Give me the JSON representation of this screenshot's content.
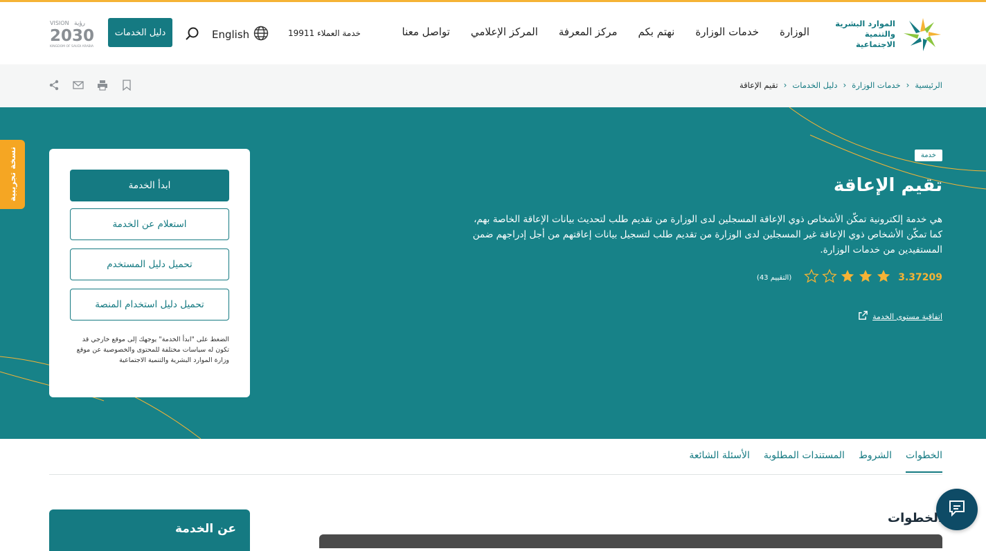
{
  "header": {
    "logo_line1": "الموارد البشرية",
    "logo_line2": "والتنمية الاجتماعية",
    "nav": [
      "الوزارة",
      "خدمات الوزارة",
      "نهتم بكم",
      "مركز المعرفة",
      "المركز الإعلامي",
      "تواصل معنا"
    ],
    "customer_service": "خدمة العملاء 19911",
    "language": "English",
    "services_guide_button": "دليل الخدمات",
    "vision_text": "VISION 2030",
    "vision_subtext": "KINGDOM OF SAUDI ARABIA",
    "vision_arabic": "رؤية"
  },
  "breadcrumb": {
    "items": [
      "الرئيسية",
      "خدمات الوزارة",
      "دليل الخدمات"
    ],
    "current": "تقيم الإعاقة"
  },
  "hero": {
    "trial_label": "نسخة تجريبية",
    "tag": "خدمة",
    "title": "تقيم الإعاقة",
    "description": "هي خدمة إلكترونية تمكّن الأشخاص ذوي الإعاقة المسجلين لدى الوزارة من تقديم طلب لتحديث بيانات الإعاقة الخاصة بهم، كما تمكّن الأشخاص ذوي الإعاقة غير المسجلين لدى الوزارة من تقديم طلب لتسجيل بيانات إعاقتهم من أجل إدراجهم ضمن المستفيدين من خدمات الوزارة.",
    "rating_score": "3.37209",
    "rating_count": "(التقييم 43)",
    "rating_value": 3.37,
    "rating_max": 5,
    "sla_link": "اتفاقية مستوى الخدمة"
  },
  "actions": {
    "start": "ابدأ الخدمة",
    "inquire": "استعلام عن الخدمة",
    "user_guide": "تحميل دليل المستخدم",
    "platform_guide": "تحميل دليل استخدام المنصة",
    "note": "الضغط على \"ابدأ الخدمة\" يوجهك إلى موقع خارجي قد تكون له سياسات مختلفة للمحتوى والخصوصية عن موقع وزارة الموارد البشرية والتنمية الاجتماعية"
  },
  "tabs": [
    "الخطوات",
    "الشروط",
    "المستندات المطلوبة",
    "الأسئلة الشائعة"
  ],
  "active_tab": "الخطوات",
  "content": {
    "steps_title": "الخطوات",
    "about_title": "عن الخدمة"
  },
  "colors": {
    "primary": "#157a82",
    "hero_bg": "#178288",
    "accent": "#f5b335",
    "trial": "#f5a623"
  }
}
